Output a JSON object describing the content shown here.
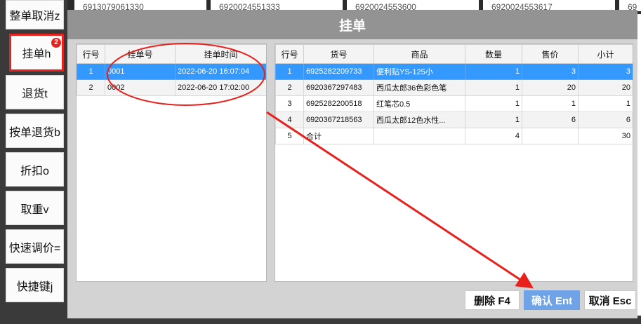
{
  "sidebar": {
    "items": [
      {
        "label": "整单取消z"
      },
      {
        "label": "挂单h",
        "badge": "2"
      },
      {
        "label": "退货t"
      },
      {
        "label": "按单退货b"
      },
      {
        "label": "折扣o"
      },
      {
        "label": "取重v"
      },
      {
        "label": "快速调价="
      },
      {
        "label": "快捷键j"
      }
    ]
  },
  "background": {
    "cells": [
      "6913079061330",
      "6920024551333",
      "6920024553600",
      "6920024553617",
      "69"
    ]
  },
  "dialog": {
    "title": "挂单",
    "orders": {
      "headers": [
        "行号",
        "挂单号",
        "挂单时间"
      ],
      "rows": [
        {
          "no": "1",
          "id": "0001",
          "time": "2022-06-20 16:07:04"
        },
        {
          "no": "2",
          "id": "0002",
          "time": "2022-06-20 17:02:00"
        }
      ]
    },
    "items": {
      "headers": [
        "行号",
        "货号",
        "商品",
        "数量",
        "售价",
        "小计"
      ],
      "rows": [
        {
          "no": "1",
          "code": "6925282209733",
          "name": "便利贴YS-125小",
          "qty": "1",
          "price": "3",
          "subtotal": "3"
        },
        {
          "no": "2",
          "code": "6920367297483",
          "name": "西瓜太郎36色彩色笔",
          "qty": "1",
          "price": "20",
          "subtotal": "20"
        },
        {
          "no": "3",
          "code": "6925282200518",
          "name": "红笔芯0.5",
          "qty": "1",
          "price": "1",
          "subtotal": "1"
        },
        {
          "no": "4",
          "code": "6920367218563",
          "name": "西瓜太郎12色水性...",
          "qty": "1",
          "price": "6",
          "subtotal": "6"
        },
        {
          "no": "5",
          "code": "合计",
          "name": "",
          "qty": "4",
          "price": "",
          "subtotal": "30"
        }
      ]
    },
    "buttons": {
      "delete": "删除 F4",
      "confirm": "确认 Ent",
      "cancel": "取消 Esc"
    }
  },
  "colors": {
    "selection": "#3399ff",
    "annotation": "#e8211c",
    "confirm_button": "#6fa3e8"
  }
}
